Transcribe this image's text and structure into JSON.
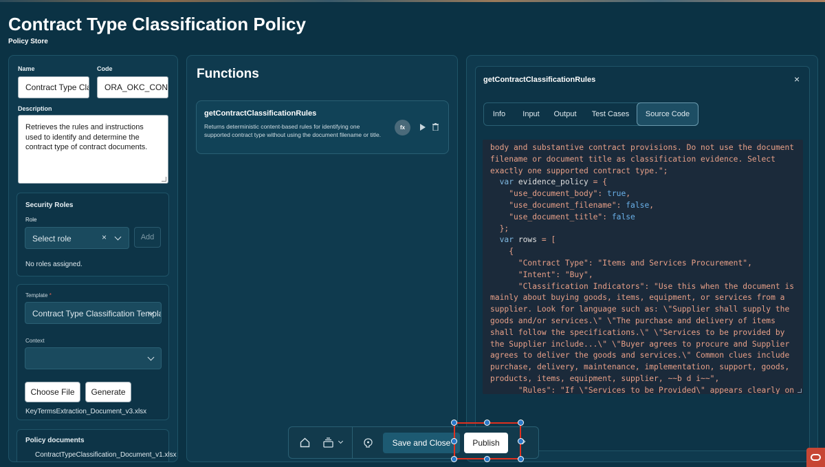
{
  "page": {
    "title": "Contract Type Classification Policy",
    "subtitle": "Policy Store"
  },
  "form": {
    "name_label": "Name",
    "name_value": "Contract Type Classification Policy",
    "code_label": "Code",
    "code_value": "ORA_OKC_CONTRACT_TYPE",
    "description_label": "Description",
    "description_value": "Retrieves the rules and instructions used to identify and determine the contract type of contract documents.",
    "security": {
      "title": "Security Roles",
      "role_label": "Role",
      "role_placeholder": "Select role",
      "add_label": "Add",
      "empty_text": "No roles assigned."
    },
    "template": {
      "label": "Template",
      "required_mark": "*",
      "value": "Contract Type Classification Template",
      "context_label": "Context",
      "context_value": "",
      "choose_file_label": "Choose File",
      "generate_label": "Generate",
      "file_name": "KeyTermsExtraction_Document_v3.xlsx"
    },
    "policy_documents": {
      "title": "Policy documents",
      "items": [
        "ContractTypeClassification_Document_v1.xlsx"
      ]
    }
  },
  "functions": {
    "title": "Functions",
    "items": [
      {
        "name": "getContractClassificationRules",
        "description": "Returns deterministic content-based rules for identifying one supported contract type without using the document filename or title.",
        "badge": "fx"
      }
    ]
  },
  "detail": {
    "title": "getContractClassificationRules",
    "close_glyph": "×",
    "tabs": [
      "Info",
      "Input",
      "Output",
      "Test Cases",
      "Source Code"
    ],
    "active_tab": "Source Code",
    "code_lines": [
      "body and substantive contract provisions. Do not use the document",
      "filename or document title as classification evidence. Select",
      "exactly one supported contract type.\";",
      "  var evidence_policy = {",
      "    \"use_document_body\": true,",
      "    \"use_document_filename\": false,",
      "    \"use_document_title\": false",
      "  };",
      "  var rows = [",
      "    {",
      "      \"Contract Type\": \"Items and Services Procurement\",",
      "      \"Intent\": \"Buy\",",
      "      \"Classification Indicators\": \"Use this when the document is",
      "mainly about buying goods, items, equipment, or services from a",
      "supplier. Look for language such as: \\\"Supplier shall supply the",
      "goods and/or services.\\\" \\\"The purchase and delivery of items",
      "shall follow the specifications.\\\" \\\"Services to be provided by",
      "the Supplier include...\\\" \\\"Buyer agrees to procure and Supplier",
      "agrees to deliver the goods and services.\\\" Common clues include",
      "purchase, delivery, maintenance, implementation, support, goods,",
      "products, items, equipment, supplier, ~~b d i~~\",",
      "      \"Rules\": \"If \\\"Services to be Provided\\\" appears clearly on"
    ]
  },
  "toolbar": {
    "save_close_label": "Save and Close",
    "publish_label": "Publish"
  },
  "colors": {
    "background": "#0b3244",
    "panel": "#0f3a4e",
    "selection": "#e0301e",
    "handle": "#2a78c8",
    "brand": "#c74634"
  },
  "icons": [
    "home-icon",
    "layers-icon",
    "chevron-down-icon",
    "brain-icon",
    "play-icon",
    "trash-icon",
    "close-icon",
    "oracle-logo-icon"
  ]
}
